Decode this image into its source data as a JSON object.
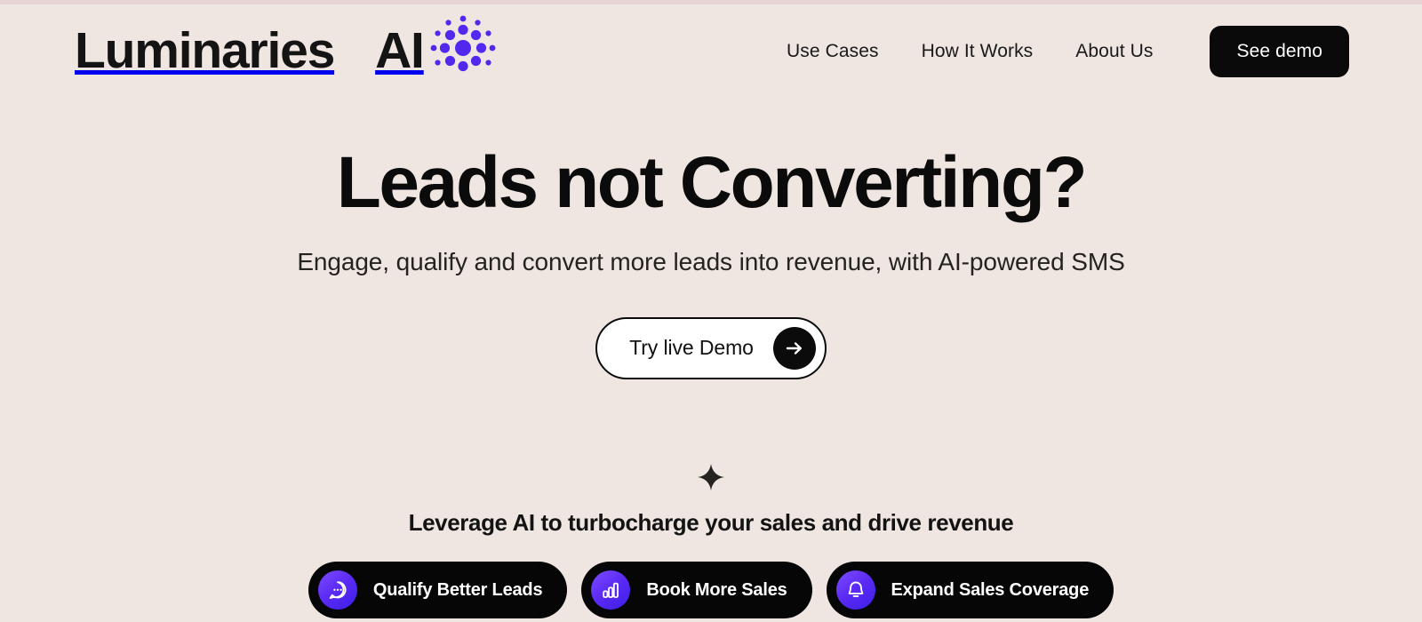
{
  "theme": {
    "background": "#efe6e1",
    "top_strip": "#e7d3d4",
    "ink": "#0b0b0b",
    "accent_purple": "#5227ee",
    "chip_bg": "#060606"
  },
  "brand": {
    "word_one": "Luminaries",
    "word_two": "AI",
    "logo_icon": "dot-burst-icon"
  },
  "nav": {
    "links": [
      {
        "label": "Use Cases",
        "name": "nav-link-use-cases"
      },
      {
        "label": "How It Works",
        "name": "nav-link-how-it-works"
      },
      {
        "label": "About Us",
        "name": "nav-link-about-us"
      }
    ],
    "cta_label": "See demo"
  },
  "hero": {
    "headline": "Leads not Converting?",
    "subheadline": "Engage, qualify and convert more leads into revenue, with AI-powered SMS",
    "cta_label": "Try live Demo",
    "cta_icon": "arrow-right-icon"
  },
  "features": {
    "sparkle_icon": "sparkle-icon",
    "title": "Leverage AI to turbocharge your sales and drive revenue",
    "chips": [
      {
        "label": "Qualify Better Leads",
        "icon": "chat-bubble-icon"
      },
      {
        "label": "Book More Sales",
        "icon": "bar-chart-icon"
      },
      {
        "label": "Expand Sales Coverage",
        "icon": "bell-icon"
      }
    ]
  }
}
